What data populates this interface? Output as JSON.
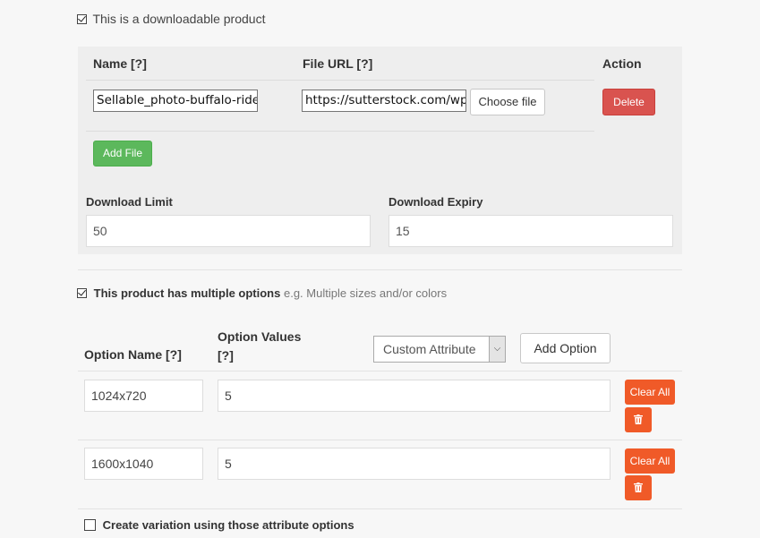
{
  "downloadable": {
    "label": "This is a downloadable product",
    "checked": true
  },
  "files_table": {
    "headers": {
      "name": "Name [?]",
      "file_url": "File URL [?]",
      "action": "Action"
    },
    "rows": [
      {
        "name": "Sellable_photo-buffalo-ride",
        "url": "https://sutterstock.com/wp",
        "choose_label": "Choose file",
        "delete_label": "Delete"
      }
    ],
    "add_file_label": "Add File"
  },
  "download": {
    "limit_label": "Download Limit",
    "limit_value": "50",
    "expiry_label": "Download Expiry",
    "expiry_value": "15"
  },
  "multiple_options": {
    "label": "This product has multiple options",
    "hint": "e.g. Multiple sizes and/or colors",
    "checked": true
  },
  "options_table": {
    "option_name_header": "Option Name [?]",
    "option_values_header_line1": "Option Values",
    "option_values_header_line2": "[?]",
    "attribute_select": "Custom Attribute",
    "add_option_label": "Add Option",
    "rows": [
      {
        "name": "1024x720",
        "values": "5",
        "clear_label": "Clear All"
      },
      {
        "name": "1600x1040",
        "values": "5",
        "clear_label": "Clear All"
      }
    ]
  },
  "variation": {
    "label": "Create variation using those attribute options",
    "checked": false
  },
  "icons": {
    "trash": "trash-icon",
    "checkbox": "check-icon",
    "dropdown": "chevron-down-icon"
  },
  "colors": {
    "delete": "#d9534f",
    "add_file": "#5cb85c",
    "clear": "#f05a28"
  }
}
